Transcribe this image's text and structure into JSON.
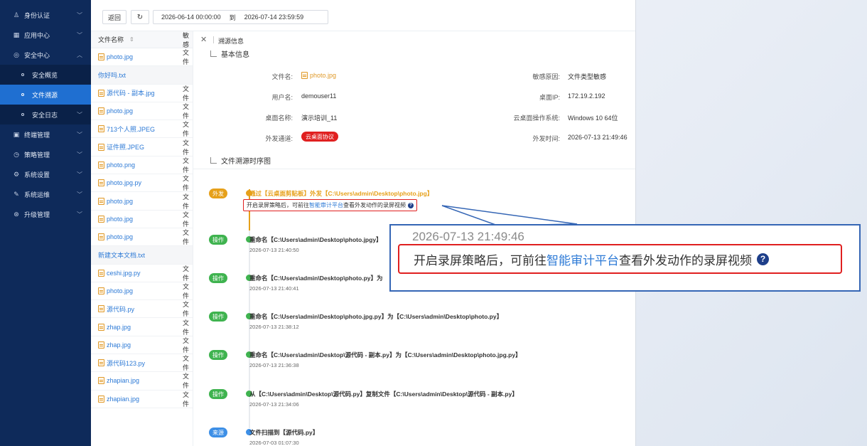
{
  "sidebar": {
    "items": [
      {
        "label": "身份认证",
        "icon": "user-key-icon"
      },
      {
        "label": "应用中心",
        "icon": "grid-icon"
      },
      {
        "label": "安全中心",
        "icon": "shield-icon"
      },
      {
        "label": "安全概览",
        "icon": "dot-icon"
      },
      {
        "label": "文件溯源",
        "icon": "dot-icon"
      },
      {
        "label": "安全日志",
        "icon": "dot-icon"
      },
      {
        "label": "终端管理",
        "icon": "monitor-icon"
      },
      {
        "label": "策略管理",
        "icon": "clock-icon"
      },
      {
        "label": "系统设置",
        "icon": "gear-icon"
      },
      {
        "label": "系统运维",
        "icon": "wrench-icon"
      },
      {
        "label": "升级管理",
        "icon": "upgrade-icon"
      }
    ]
  },
  "toolbar": {
    "back_label": "返回",
    "start_time": "2026-06-14 00:00:00",
    "to_label": "到",
    "end_time": "2026-07-14 23:59:59"
  },
  "filelist": {
    "col_name": "文件名称",
    "col_type": "敏感",
    "type_cell": "文件",
    "rows": [
      {
        "name": "photo.jpg",
        "icon": true,
        "type": true
      },
      {
        "name": "你好吗.txt",
        "icon": false,
        "type": false
      },
      {
        "name": "源代码 - 副本.jpg",
        "icon": true,
        "type": true
      },
      {
        "name": "photo.jpg",
        "icon": true,
        "type": true
      },
      {
        "name": "713个人照.JPEG",
        "icon": true,
        "type": true
      },
      {
        "name": "证件照.JPEG",
        "icon": true,
        "type": true
      },
      {
        "name": "photo.png",
        "icon": true,
        "type": true
      },
      {
        "name": "photo.jpg.py",
        "icon": true,
        "type": true
      },
      {
        "name": "photo.jpg",
        "icon": true,
        "type": true
      },
      {
        "name": "photo.jpg",
        "icon": true,
        "type": true
      },
      {
        "name": "photo.jpg",
        "icon": true,
        "type": true
      },
      {
        "name": "新建文本文档.txt",
        "icon": false,
        "type": false
      },
      {
        "name": "ceshi.jpg.py",
        "icon": true,
        "type": true
      },
      {
        "name": "photo.jpg",
        "icon": true,
        "type": true
      },
      {
        "name": "源代码.py",
        "icon": true,
        "type": true
      },
      {
        "name": "zhap.jpg",
        "icon": true,
        "type": true
      },
      {
        "name": "zhap.jpg",
        "icon": true,
        "type": true
      },
      {
        "name": "源代码123.py",
        "icon": true,
        "type": true
      },
      {
        "name": "zhapian.jpg",
        "icon": true,
        "type": true
      },
      {
        "name": "zhapian.jpg",
        "icon": true,
        "type": true
      }
    ]
  },
  "panel": {
    "title": "溯源信息",
    "basic_title": "基本信息",
    "fields": {
      "file_name_k": "文件名:",
      "file_name_v": "photo.jpg",
      "reason_k": "敏感原因:",
      "reason_v": "文件类型敏感",
      "user_k": "用户名:",
      "user_v": "demouser11",
      "ip_k": "桌面IP:",
      "ip_v": "172.19.2.192",
      "desk_k": "桌面名称:",
      "desk_v": "演示培训_11",
      "os_k": "云桌面操作系统:",
      "os_v": "Windows 10 64位",
      "channel_k": "外发通道:",
      "channel_v": "云桌面协议",
      "time_k": "外发时间:",
      "time_v": "2026-07-13 21:49:46"
    },
    "timeline_title": "文件溯源时序图",
    "timeline": [
      {
        "tag": "外发",
        "color": "#e6a01a",
        "title": "通过【云桌面剪贴板】外发【C:\\Users\\admin\\Desktop\\photo.jpg】",
        "time": "2026-07-13 21:49:46"
      },
      {
        "tag": "操作",
        "color": "#3fb34f",
        "title": "重命名【C:\\Users\\admin\\Desktop\\photo.jpgy】",
        "time": "2026-07-13 21:40:50"
      },
      {
        "tag": "操作",
        "color": "#3fb34f",
        "title": "重命名【C:\\Users\\admin\\Desktop\\photo.py】为",
        "time": "2026-07-13 21:40:41"
      },
      {
        "tag": "操作",
        "color": "#3fb34f",
        "title": "重命名【C:\\Users\\admin\\Desktop\\photo.jpg.py】为【C:\\Users\\admin\\Desktop\\photo.py】",
        "time": "2026-07-13 21:38:12"
      },
      {
        "tag": "操作",
        "color": "#3fb34f",
        "title": "重命名【C:\\Users\\admin\\Desktop\\源代码 - 副本.py】为【C:\\Users\\admin\\Desktop\\photo.jpg.py】",
        "time": "2026-07-13 21:36:38"
      },
      {
        "tag": "操作",
        "color": "#3fb34f",
        "title": "从【C:\\Users\\admin\\Desktop\\源代码.py】复制文件【C:\\Users\\admin\\Desktop\\源代码 - 副本.py】",
        "time": "2026-07-13 21:34:06"
      },
      {
        "tag": "来源",
        "color": "#3d8fe6",
        "title": "文件扫描到【源代码.py】",
        "time": "2026-07-03 01:07:30"
      }
    ],
    "hint_before": "开启录屏策略后，可前往",
    "hint_link": "智能审计平台",
    "hint_after": "查看外发动作的录屏视频",
    "hint_icon": "?"
  },
  "callout": {
    "time": "2026-07-13 21:49:46",
    "before": "开启录屏策略后，可前往",
    "link": "智能审计平台",
    "after": "查看外发动作的录屏视频",
    "icon": "?"
  },
  "colors": {
    "accent": "#1f6fd1",
    "link": "#2d7ad6",
    "highlight": "#e02020",
    "warn": "#e6a01a",
    "ok": "#3fb34f"
  }
}
